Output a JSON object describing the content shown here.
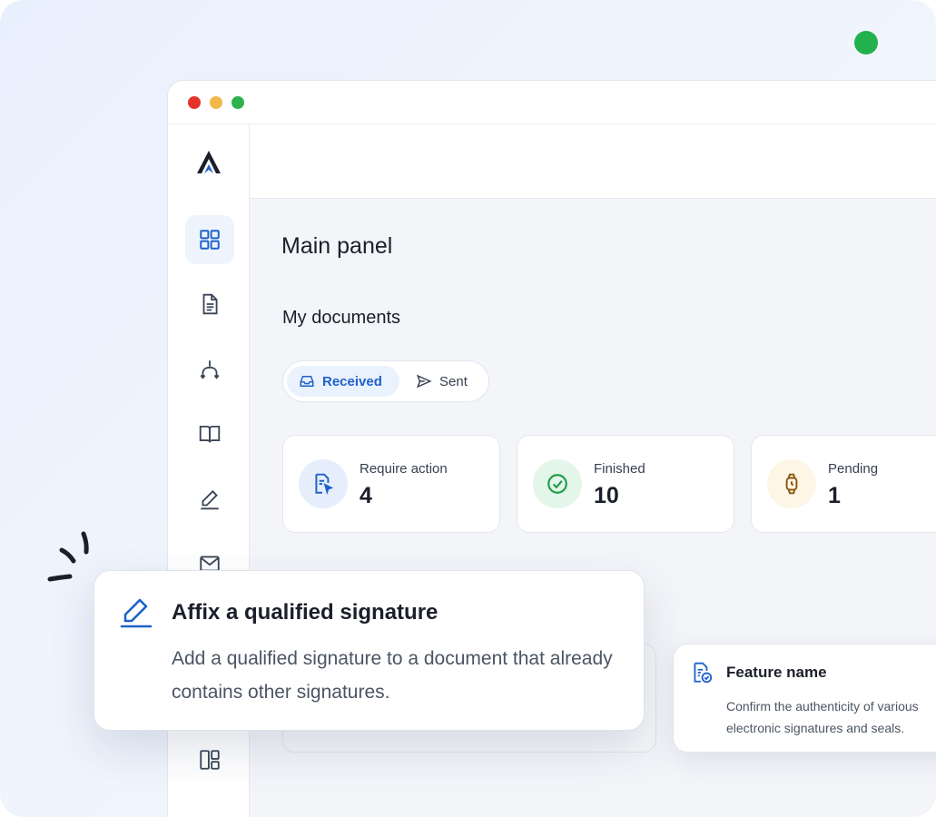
{
  "titlebar": {
    "traffic_lights": [
      "#e5332a",
      "#f1b84a",
      "#2fb14d"
    ]
  },
  "sidebar": {
    "items": [
      {
        "icon": "dashboard-grid-icon",
        "active": true
      },
      {
        "icon": "document-icon",
        "active": false
      },
      {
        "icon": "workflow-icon",
        "active": false
      },
      {
        "icon": "book-icon",
        "active": false
      },
      {
        "icon": "pen-sign-icon",
        "active": false
      },
      {
        "icon": "mail-icon",
        "active": false
      },
      {
        "icon": "layout-icon",
        "active": false
      }
    ]
  },
  "main": {
    "title": "Main panel",
    "section_title": "My documents",
    "tabs": [
      {
        "label": "Received",
        "icon": "inbox-icon",
        "active": true
      },
      {
        "label": "Sent",
        "icon": "send-icon",
        "active": false
      }
    ],
    "stats": [
      {
        "label": "Require action",
        "value": "4",
        "icon": "document-cursor-icon",
        "color": "#1d62c9"
      },
      {
        "label": "Finished",
        "value": "10",
        "icon": "check-circle-icon",
        "color": "#1f9d4a"
      },
      {
        "label": "Pending",
        "value": "1",
        "icon": "watch-icon",
        "color": "#b7791f"
      }
    ],
    "feature_card": {
      "title": "Feature name",
      "description": "Confirm the authenticity of various electronic signatures and seals.",
      "icon": "document-check-icon"
    }
  },
  "popup": {
    "title": "Affix a qualified signature",
    "description": "Add a qualified signature to a document that already contains other signatures.",
    "icon": "pen-underline-icon"
  },
  "colors": {
    "accent": "#1d62c9",
    "background": "#e9f0fd"
  }
}
